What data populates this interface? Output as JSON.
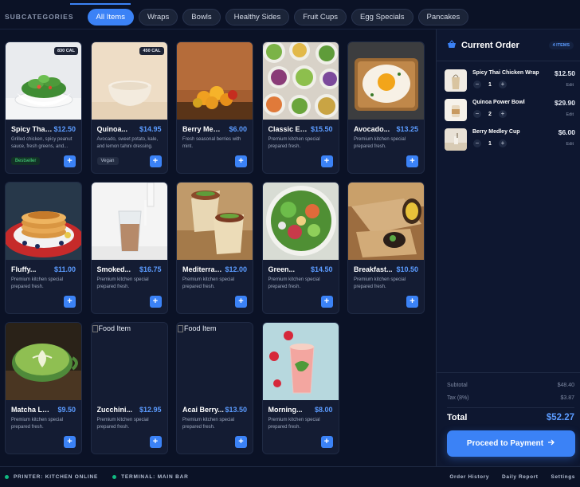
{
  "subcategories": {
    "label": "SUBCATEGORIES",
    "chips": [
      "All Items",
      "Wraps",
      "Bowls",
      "Healthy Sides",
      "Fruit Cups",
      "Egg Specials",
      "Pancakes"
    ]
  },
  "products": [
    {
      "name": "Spicy Thai...",
      "price": "$12.50",
      "desc": "Grilled chicken, spicy peanut sauce, fresh greens, and...",
      "cal": "830 CAL",
      "tag": "Bestseller",
      "image": "salad-bowl"
    },
    {
      "name": "Quinoa...",
      "price": "$14.95",
      "desc": "Avocado, sweet potato, kale, and lemon tahini dressing.",
      "cal": "450 CAL",
      "tag": "Vegan",
      "image": "empty-bowl"
    },
    {
      "name": "Berry Medle...",
      "price": "$6.00",
      "desc": "Fresh seasonal berries with mint.",
      "image": "oranges"
    },
    {
      "name": "Classic Egg...",
      "price": "$15.50",
      "desc": "Premium kitchen special prepared fresh.",
      "image": "many-bowls"
    },
    {
      "name": "Avocado...",
      "price": "$13.25",
      "desc": "Premium kitchen special prepared fresh.",
      "image": "egg-toast"
    },
    {
      "name": "Fluffy...",
      "price": "$11.00",
      "desc": "Premium kitchen special prepared fresh.",
      "image": "pancakes"
    },
    {
      "name": "Smoked...",
      "price": "$16.75",
      "desc": "Premium kitchen special prepared fresh.",
      "image": "smoothie"
    },
    {
      "name": "Mediterran...",
      "price": "$12.00",
      "desc": "Premium kitchen special prepared fresh.",
      "image": "wraps"
    },
    {
      "name": "Green...",
      "price": "$14.50",
      "desc": "Premium kitchen special prepared fresh.",
      "image": "green-salad"
    },
    {
      "name": "Breakfast...",
      "price": "$10.50",
      "desc": "Premium kitchen special prepared fresh.",
      "image": "burrito"
    },
    {
      "name": "Matcha Latte...",
      "price": "$9.50",
      "desc": "Premium kitchen special prepared fresh.",
      "image": "matcha"
    },
    {
      "name": "Zucchini...",
      "price": "$12.95",
      "desc": "Premium kitchen special prepared fresh.",
      "image": "broken",
      "alt": "Food Item"
    },
    {
      "name": "Acai Berry...",
      "price": "$13.50",
      "desc": "Premium kitchen special prepared fresh.",
      "image": "broken",
      "alt": "Food Item"
    },
    {
      "name": "Morning...",
      "price": "$8.00",
      "desc": "Premium kitchen special prepared fresh.",
      "image": "juice"
    }
  ],
  "order": {
    "title": "Current Order",
    "badge": "4 ITEMS",
    "items": [
      {
        "name": "Spicy Thai Chicken Wrap",
        "price": "$12.50",
        "qty": "1",
        "edit": "Edit"
      },
      {
        "name": "Quinoa Power Bowl",
        "price": "$29.90",
        "qty": "2",
        "edit": "Edit"
      },
      {
        "name": "Berry Medley Cup",
        "price": "$6.00",
        "qty": "1",
        "edit": "Edit"
      }
    ],
    "subtotal_label": "Subtotal",
    "subtotal": "$48.40",
    "tax_label": "Tax (8%)",
    "tax": "$3.87",
    "total_label": "Total",
    "total": "$52.27",
    "pay_label": "Proceed to Payment"
  },
  "footer": {
    "printer": "PRINTER: KITCHEN ONLINE",
    "terminal": "TERMINAL: MAIN BAR",
    "links": [
      "Order History",
      "Daily Report",
      "Settings"
    ]
  },
  "colors": {
    "accent": "#3b82f6",
    "online": "#10b981",
    "price": "#5b9bff"
  }
}
